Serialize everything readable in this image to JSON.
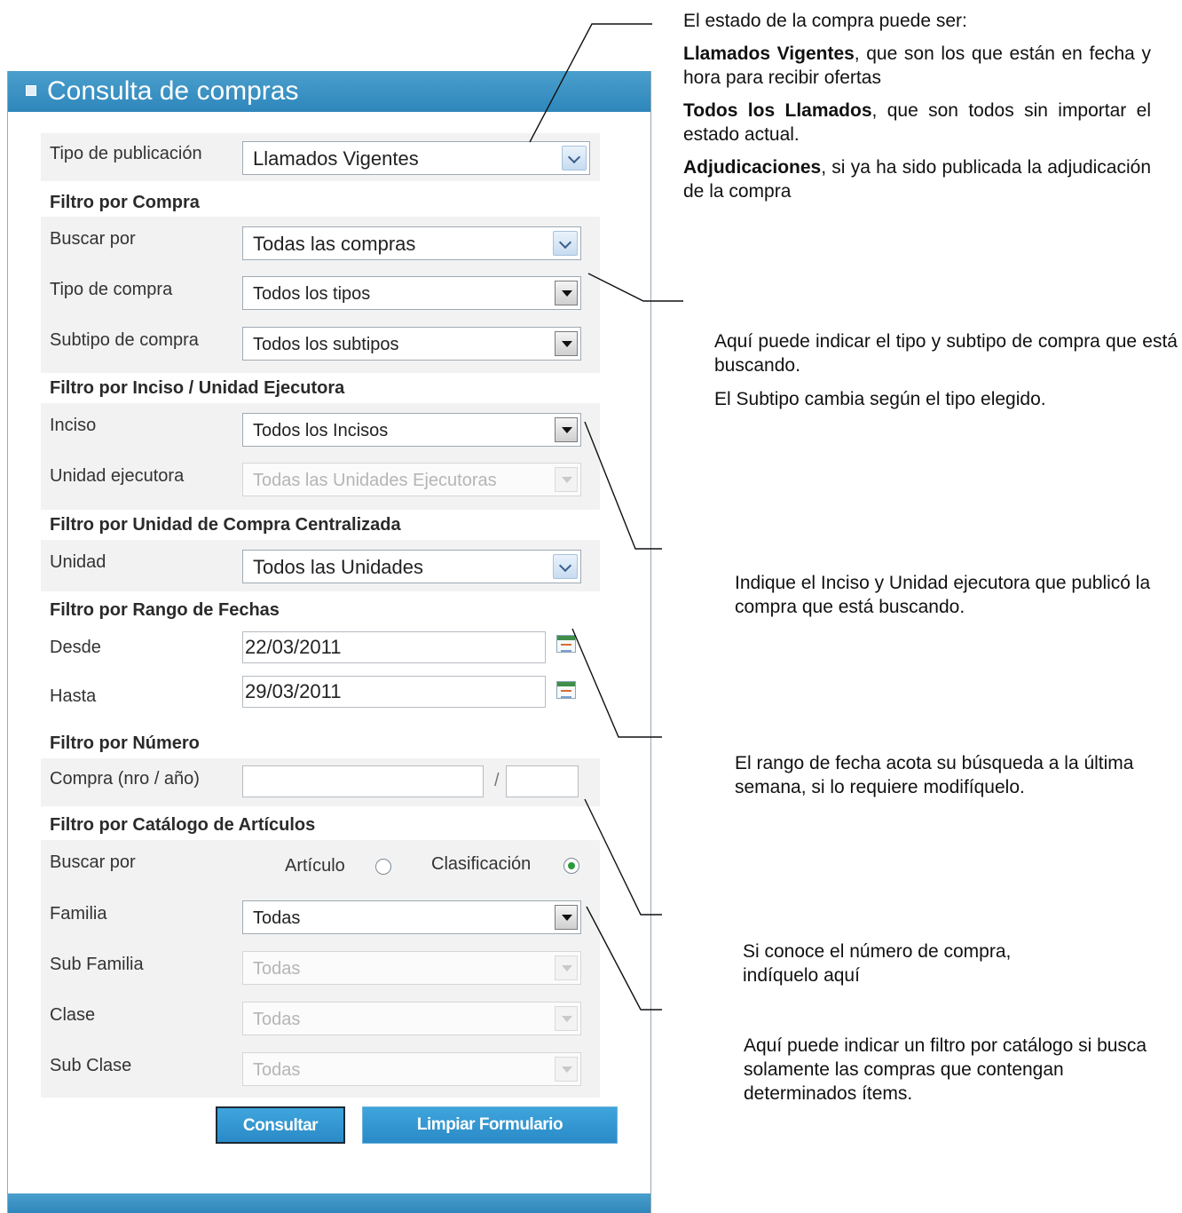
{
  "panel": {
    "title": "Consulta de compras"
  },
  "form": {
    "tipo_publicacion": {
      "label": "Tipo de publicación",
      "value": "Llamados Vigentes"
    },
    "sec_compra": "Filtro por Compra",
    "buscar_por": {
      "label": "Buscar por",
      "value": "Todas las compras"
    },
    "tipo_compra": {
      "label": "Tipo de compra",
      "value": "Todos los tipos"
    },
    "subtipo_compra": {
      "label": "Subtipo de compra",
      "value": "Todos los subtipos"
    },
    "sec_inciso": "Filtro por Inciso / Unidad Ejecutora",
    "inciso": {
      "label": "Inciso",
      "value": "Todos los Incisos"
    },
    "unidad_ejecutora": {
      "label": "Unidad ejecutora",
      "value": "Todas las Unidades Ejecutoras"
    },
    "sec_unidad": "Filtro por Unidad de Compra Centralizada",
    "unidad": {
      "label": "Unidad",
      "value": "Todos las Unidades"
    },
    "sec_fechas": "Filtro por Rango de Fechas",
    "desde": {
      "label": "Desde",
      "value": "22/03/2011"
    },
    "hasta": {
      "label": "Hasta",
      "value": "29/03/2011"
    },
    "sec_numero": "Filtro por Número",
    "compra_nro": {
      "label": "Compra (nro / año)",
      "separator": "/",
      "nro": "",
      "anio": ""
    },
    "sec_catalogo": "Filtro por Catálogo de Artículos",
    "buscar_catalogo": {
      "label": "Buscar por",
      "opt_articulo": "Artículo",
      "opt_clasificacion": "Clasificación",
      "selected": "Clasificación"
    },
    "familia": {
      "label": "Familia",
      "value": "Todas"
    },
    "sub_familia": {
      "label": "Sub Familia",
      "value": "Todas"
    },
    "clase": {
      "label": "Clase",
      "value": "Todas"
    },
    "sub_clase": {
      "label": "Sub Clase",
      "value": "Todas"
    },
    "btn_consultar": "Consultar",
    "btn_limpiar": "Limpiar Formulario"
  },
  "notes": {
    "estado_intro": "El estado de la compra puede ser:",
    "vigentes_bold": "Llamados Vigentes",
    "vigentes_rest": ", que son los que están en fecha y hora para recibir ofertas",
    "todos_bold": "Todos los Llamados",
    "todos_rest": ", que son todos sin importar el estado actual.",
    "adj_bold": "Adjudicaciones",
    "adj_rest": ", si ya ha sido publicada la adjudicación de la compra",
    "tipo_1": "Aquí puede indicar el tipo y subtipo de compra que está buscando.",
    "tipo_2": "El Subtipo cambia según el tipo elegido.",
    "inciso": "Indique el Inciso y Unidad ejecutora que publicó la compra que está buscando.",
    "fecha": "El rango de fecha acota su búsqueda a la última semana, si lo requiere modifíquelo.",
    "numero": "Si conoce el número de compra, indíquelo aquí",
    "catalogo": "Aquí puede indicar un filtro por catálogo si busca solamente las compras que contengan determinados ítems."
  },
  "colors": {
    "header_blue": "#2e86bb",
    "button_blue": "#3fa5dc",
    "row_gray": "#f2f2f2"
  }
}
